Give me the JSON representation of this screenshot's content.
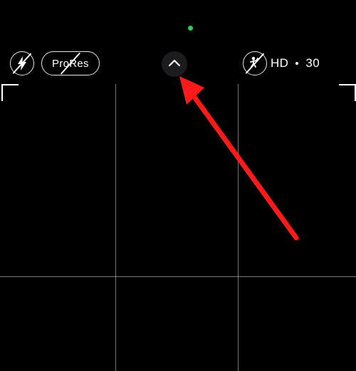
{
  "toolbar": {
    "prores_label": "ProRes",
    "hd_label": "HD",
    "fps_label": "30"
  },
  "icons": {
    "flash": "flash-off-icon",
    "expand": "chevron-up-icon",
    "action": "action-mode-icon"
  },
  "annotation": {
    "color": "#ff1a1a"
  }
}
